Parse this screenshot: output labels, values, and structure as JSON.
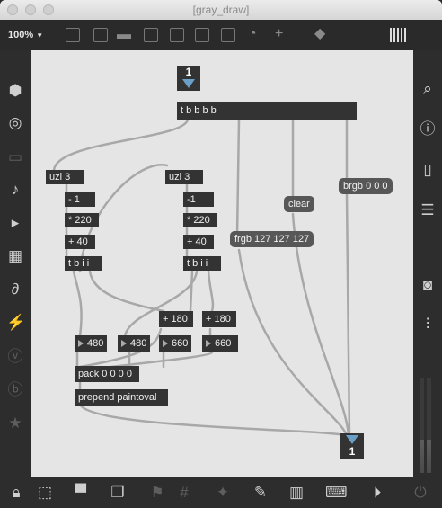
{
  "window": {
    "title": "[gray_draw]"
  },
  "toolbar": {
    "zoom": "100%"
  },
  "patch": {
    "inlet_top": "1",
    "outlet_bottom": "1",
    "trigger_main": "t b b b b",
    "uzi_left": "uzi 3",
    "uzi_right": "uzi 3",
    "minus_left": "- 1",
    "minus_right": "-1",
    "mul_left": "* 220",
    "mul_right": "* 220",
    "add_left": "+ 40",
    "add_right": "+ 40",
    "tbii_left": "t b i i",
    "tbii_right": "t b i i",
    "add180_a": "+ 180",
    "add180_b": "+ 180",
    "num_480_a": "480",
    "num_480_b": "480",
    "num_660_a": "660",
    "num_660_b": "660",
    "pack": "pack 0 0 0 0",
    "prepend": "prepend paintoval",
    "msg_clear": "clear",
    "msg_frgb": "frgb 127 127 127",
    "msg_brgb": "brgb 0 0 0"
  },
  "icons": {
    "left": [
      "cube-icon",
      "target-icon",
      "keyboard-icon",
      "music-note-icon",
      "play-list-icon",
      "image-icon",
      "paperclip-icon",
      "plug-icon",
      "v-icon",
      "b-icon",
      "star-icon"
    ],
    "right": [
      "search-icon",
      "info-icon",
      "book-icon",
      "list-icon",
      "camera-icon",
      "mixer-icon"
    ],
    "bottom": [
      "lock-icon",
      "select-icon",
      "presentation-icon",
      "windows-icon",
      "flag-icon",
      "grid-icon",
      "wand-icon",
      "wrench-icon",
      "piano-icon",
      "keyboard-icon",
      "play-icon",
      "power-icon"
    ]
  },
  "meters": {
    "left_level": 0.35,
    "right_level": 0.35
  }
}
